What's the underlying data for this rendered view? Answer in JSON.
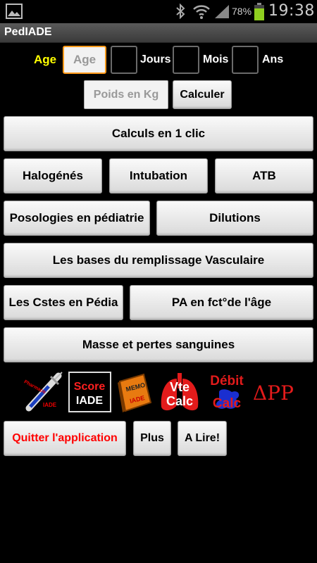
{
  "statusbar": {
    "battery": "78%",
    "time": "19:38"
  },
  "app": {
    "title": "PedIADE"
  },
  "age_row": {
    "label": "Age",
    "age_placeholder": "Age",
    "jours": "Jours",
    "mois": "Mois",
    "ans": "Ans"
  },
  "weight": {
    "placeholder": "Poids en Kg",
    "calc_button": "Calculer"
  },
  "buttons": {
    "calculs": "Calculs en 1 clic",
    "halogenes": "Halogénés",
    "intubation": "Intubation",
    "atb": "ATB",
    "posologies": "Posologies en  pédiatrie",
    "dilutions": "Dilutions",
    "remplissage": "Les bases du remplissage Vasculaire",
    "cstes": "Les Cstes en Pédia",
    "pa": "PA en fct°de l'âge",
    "masse": "Masse et pertes sanguines"
  },
  "apps": {
    "pharmaco": "Pharmaco",
    "pharmaco_sub": "IADE",
    "score_line1": "Score",
    "score_line2": "IADE",
    "memo_line1": "MEMO",
    "memo_line2": "IADE",
    "vte_line1": "Vte",
    "vte_line2": "Calc",
    "debit_line1": "Débit",
    "debit_line2": "Calc",
    "dpp": "ΔPP"
  },
  "bottom": {
    "quit": "Quitter l'application",
    "plus": "Plus",
    "lire": "A Lire!"
  },
  "colors": {
    "accent_yellow": "#ffff00",
    "focus_orange": "#ff9a1a",
    "quit_red": "#ff0000"
  }
}
